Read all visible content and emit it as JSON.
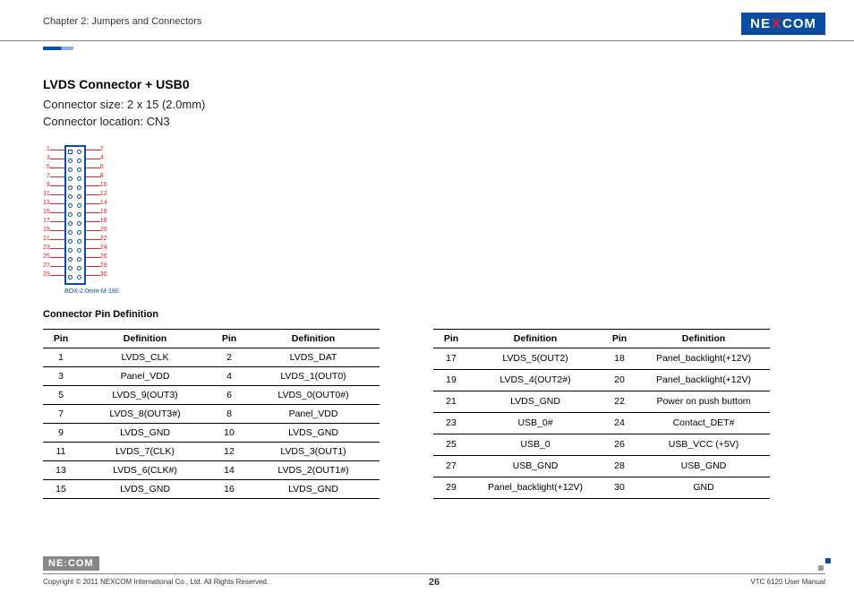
{
  "header": {
    "chapter": "Chapter 2: Jumpers and Connectors",
    "brand": "NE COM",
    "brand_x": "X"
  },
  "section": {
    "title": "LVDS Connector + USB0",
    "size_line": "Connector size:  2 x 15 (2.0mm)",
    "loc_line": "Connector location: CN3"
  },
  "diagram": {
    "left_pins": [
      "1",
      "3",
      "5",
      "7",
      "9",
      "11",
      "13",
      "15",
      "17",
      "19",
      "21",
      "23",
      "25",
      "27",
      "29"
    ],
    "right_pins": [
      "2",
      "4",
      "6",
      "8",
      "10",
      "12",
      "14",
      "16",
      "18",
      "20",
      "22",
      "24",
      "26",
      "28",
      "30"
    ],
    "caption": "BOX-2.0mm-M-180"
  },
  "table_caption": "Connector Pin Definition",
  "table_headers": {
    "pin": "Pin",
    "def": "Definition"
  },
  "table_left": [
    {
      "p1": "1",
      "d1": "LVDS_CLK",
      "p2": "2",
      "d2": "LVDS_DAT"
    },
    {
      "p1": "3",
      "d1": "Panel_VDD",
      "p2": "4",
      "d2": "LVDS_1(OUT0)"
    },
    {
      "p1": "5",
      "d1": "LVDS_9(OUT3)",
      "p2": "6",
      "d2": "LVDS_0(OUT0#)"
    },
    {
      "p1": "7",
      "d1": "LVDS_8(OUT3#)",
      "p2": "8",
      "d2": "Panel_VDD"
    },
    {
      "p1": "9",
      "d1": "LVDS_GND",
      "p2": "10",
      "d2": "LVDS_GND"
    },
    {
      "p1": "11",
      "d1": "LVDS_7(CLK)",
      "p2": "12",
      "d2": "LVDS_3(OUT1)"
    },
    {
      "p1": "13",
      "d1": "LVDS_6(CLK#)",
      "p2": "14",
      "d2": "LVDS_2(OUT1#)"
    },
    {
      "p1": "15",
      "d1": "LVDS_GND",
      "p2": "16",
      "d2": "LVDS_GND"
    }
  ],
  "table_right": [
    {
      "p1": "17",
      "d1": "LVDS_5(OUT2)",
      "p2": "18",
      "d2": "Panel_backlight(+12V)"
    },
    {
      "p1": "19",
      "d1": "LVDS_4(OUT2#)",
      "p2": "20",
      "d2": "Panel_backlight(+12V)"
    },
    {
      "p1": "21",
      "d1": "LVDS_GND",
      "p2": "22",
      "d2": "Power on push buttom"
    },
    {
      "p1": "23",
      "d1": "USB_0#",
      "p2": "24",
      "d2": "Contact_DET#"
    },
    {
      "p1": "25",
      "d1": "USB_0",
      "p2": "26",
      "d2": "USB_VCC (+5V)"
    },
    {
      "p1": "27",
      "d1": "USB_GND",
      "p2": "28",
      "d2": "USB_GND"
    },
    {
      "p1": "29",
      "d1": "Panel_backlight(+12V)",
      "p2": "30",
      "d2": "GND"
    }
  ],
  "footer": {
    "copyright": "Copyright © 2011 NEXCOM International Co., Ltd. All Rights Reserved.",
    "page": "26",
    "manual": "VTC 6120 User Manual",
    "brand_grey": "NE COM"
  }
}
